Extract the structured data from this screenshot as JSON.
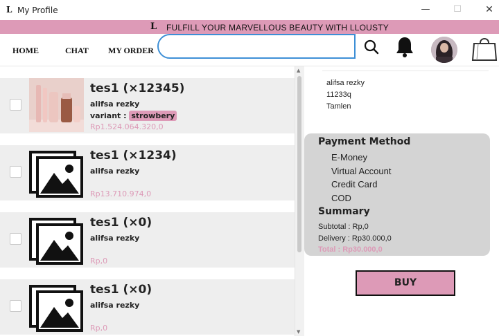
{
  "window": {
    "title": "My Profile",
    "logo_glyph": "L",
    "minimize": "—",
    "maximize": "☐",
    "close": "✕"
  },
  "banner": {
    "logo_glyph": "L",
    "text": "FULFILL YOUR MARVELLOUS BEAUTY WITH LLOUSTY"
  },
  "nav": {
    "items": [
      "HOME",
      "CHAT",
      "MY ORDER"
    ],
    "search": {
      "placeholder": "",
      "value": ""
    },
    "icons": [
      "search-icon",
      "bell-icon",
      "avatar",
      "shopping-bag-icon"
    ]
  },
  "cart": [
    {
      "title": "tes1 (×12345)",
      "buyer": "alifsa rezky",
      "variant_label": "variant :",
      "variant": "strowbery",
      "price": "Rp1.524.064.320,0",
      "image": "product-photo"
    },
    {
      "title": "tes1 (×1234)",
      "buyer": "alifsa rezky",
      "price": "Rp13.710.974,0",
      "image": "image-placeholder-icon"
    },
    {
      "title": "tes1 (×0)",
      "buyer": "alifsa rezky",
      "price": "Rp,0",
      "image": "image-placeholder-icon"
    },
    {
      "title": "tes1 (×0)",
      "buyer": "alifsa rezky",
      "price": "Rp,0",
      "image": "image-placeholder-icon"
    }
  ],
  "address": {
    "name": "alifsa rezky",
    "line1": "11233q",
    "line2": "Tamlen"
  },
  "payment": {
    "title": "Payment Method",
    "options": [
      "E-Money",
      "Virtual Account",
      "Credit Card",
      "COD"
    ]
  },
  "summary": {
    "title": "Summary",
    "subtotal": "Subtotal : Rp,0",
    "delivery": "Delivery : Rp30.000,0",
    "total": "Total : Rp30.000,0"
  },
  "buy_label": "BUY",
  "colors": {
    "accent": "#dd9ab7",
    "search_border": "#3d8fd6",
    "card_bg": "#eeeeee",
    "panel_bg": "#d4d4d4"
  }
}
